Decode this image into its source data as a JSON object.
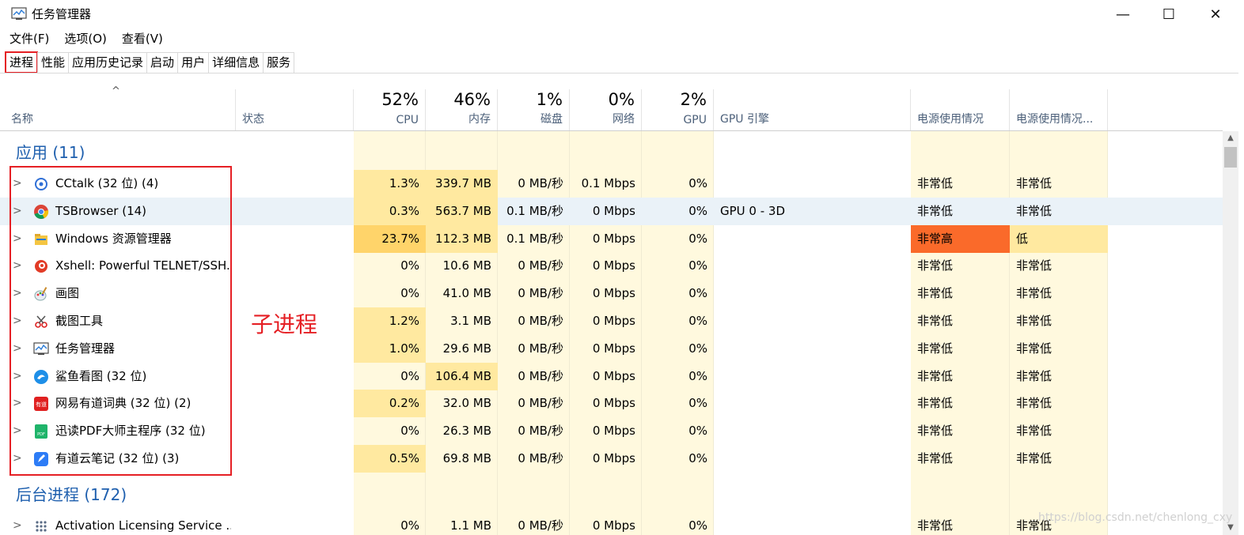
{
  "window": {
    "title": "任务管理器",
    "minimize": "—",
    "maximize": "☐",
    "close": "✕"
  },
  "menu": [
    "文件(F)",
    "选项(O)",
    "查看(V)"
  ],
  "tabs": [
    "进程",
    "性能",
    "应用历史记录",
    "启动",
    "用户",
    "详细信息",
    "服务"
  ],
  "active_tab": "进程",
  "header": {
    "sort_caret": "^",
    "name": "名称",
    "status": "状态",
    "cpu_pct": "52%",
    "cpu": "CPU",
    "mem_pct": "46%",
    "mem": "内存",
    "disk_pct": "1%",
    "disk": "磁盘",
    "net_pct": "0%",
    "net": "网络",
    "gpu_pct": "2%",
    "gpu": "GPU",
    "gpu_engine": "GPU 引擎",
    "power": "电源使用情况",
    "power_trend": "电源使用情况..."
  },
  "groups": {
    "apps": "应用 (11)",
    "background": "后台进程 (172)"
  },
  "apps": [
    {
      "name": "CCtalk (32 位) (4)",
      "icon": "cctalk-icon",
      "cpu": "1.3%",
      "mem": "339.7 MB",
      "disk": "0 MB/秒",
      "net": "0.1 Mbps",
      "gpu": "0%",
      "gpu_engine": "",
      "power": "非常低",
      "power_trend": "非常低"
    },
    {
      "name": "TSBrowser (14)",
      "icon": "chrome-icon",
      "cpu": "0.3%",
      "mem": "563.7 MB",
      "disk": "0.1 MB/秒",
      "net": "0 Mbps",
      "gpu": "0%",
      "gpu_engine": "GPU 0 - 3D",
      "power": "非常低",
      "power_trend": "非常低"
    },
    {
      "name": "Windows 资源管理器",
      "icon": "folder-icon",
      "cpu": "23.7%",
      "mem": "112.3 MB",
      "disk": "0.1 MB/秒",
      "net": "0 Mbps",
      "gpu": "0%",
      "gpu_engine": "",
      "power": "非常高",
      "power_trend": "低"
    },
    {
      "name": "Xshell: Powerful TELNET/SSH...",
      "icon": "xshell-icon",
      "cpu": "0%",
      "mem": "10.6 MB",
      "disk": "0 MB/秒",
      "net": "0 Mbps",
      "gpu": "0%",
      "gpu_engine": "",
      "power": "非常低",
      "power_trend": "非常低"
    },
    {
      "name": "画图",
      "icon": "paint-icon",
      "cpu": "0%",
      "mem": "41.0 MB",
      "disk": "0 MB/秒",
      "net": "0 Mbps",
      "gpu": "0%",
      "gpu_engine": "",
      "power": "非常低",
      "power_trend": "非常低"
    },
    {
      "name": "截图工具",
      "icon": "snipping-tool-icon",
      "cpu": "1.2%",
      "mem": "3.1 MB",
      "disk": "0 MB/秒",
      "net": "0 Mbps",
      "gpu": "0%",
      "gpu_engine": "",
      "power": "非常低",
      "power_trend": "非常低"
    },
    {
      "name": "任务管理器",
      "icon": "task-manager-icon",
      "cpu": "1.0%",
      "mem": "29.6 MB",
      "disk": "0 MB/秒",
      "net": "0 Mbps",
      "gpu": "0%",
      "gpu_engine": "",
      "power": "非常低",
      "power_trend": "非常低"
    },
    {
      "name": "鲨鱼看图 (32 位)",
      "icon": "image-viewer-icon",
      "cpu": "0%",
      "mem": "106.4 MB",
      "disk": "0 MB/秒",
      "net": "0 Mbps",
      "gpu": "0%",
      "gpu_engine": "",
      "power": "非常低",
      "power_trend": "非常低"
    },
    {
      "name": "网易有道词典 (32 位) (2)",
      "icon": "youdao-dict-icon",
      "cpu": "0.2%",
      "mem": "32.0 MB",
      "disk": "0 MB/秒",
      "net": "0 Mbps",
      "gpu": "0%",
      "gpu_engine": "",
      "power": "非常低",
      "power_trend": "非常低"
    },
    {
      "name": "迅读PDF大师主程序 (32 位)",
      "icon": "pdf-icon",
      "cpu": "0%",
      "mem": "26.3 MB",
      "disk": "0 MB/秒",
      "net": "0 Mbps",
      "gpu": "0%",
      "gpu_engine": "",
      "power": "非常低",
      "power_trend": "非常低"
    },
    {
      "name": "有道云笔记 (32 位) (3)",
      "icon": "youdao-note-icon",
      "cpu": "0.5%",
      "mem": "69.8 MB",
      "disk": "0 MB/秒",
      "net": "0 Mbps",
      "gpu": "0%",
      "gpu_engine": "",
      "power": "非常低",
      "power_trend": "非常低"
    }
  ],
  "background": [
    {
      "name": "Activation Licensing Service ...",
      "icon": "service-icon",
      "cpu": "0%",
      "mem": "1.1 MB",
      "disk": "0 MB/秒",
      "net": "0 Mbps",
      "gpu": "0%",
      "gpu_engine": "",
      "power": "非常低",
      "power_trend": "非常低"
    }
  ],
  "annotation": {
    "label": "子进程",
    "color": "#e51f24"
  },
  "watermark": "https://blog.csdn.net/chenlong_cxy",
  "colors": {
    "heat_light": "#fff4c4",
    "heat_mid": "#ffe9a0",
    "heat_high": "#ffd46a",
    "power_very_high": "#fa6a2a",
    "group_blue": "#1e5fae",
    "selected_row": "#eaf2f8"
  }
}
